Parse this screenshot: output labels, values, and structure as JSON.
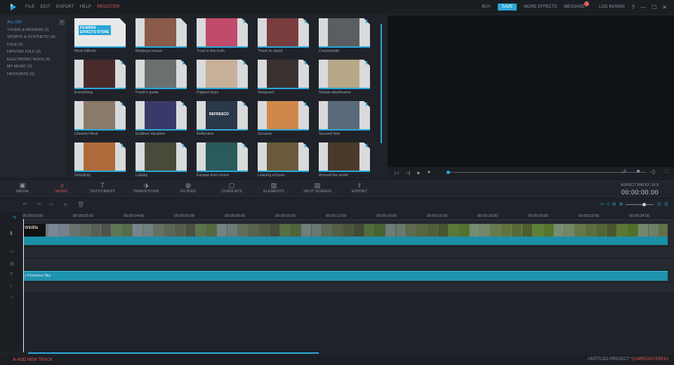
{
  "menu": [
    "FILE",
    "EDIT",
    "EXPORT",
    "HELP"
  ],
  "register_label": "REGISTER",
  "top_right": {
    "buy": "BUY",
    "save": "SAVE",
    "more_effects": "MORE EFFECTS",
    "message": "MESSAGE",
    "message_badge": "1",
    "user": "LOG IN/SIGN"
  },
  "window_controls": [
    "?",
    "—",
    "☐",
    "✕"
  ],
  "categories": [
    "ALL (20)",
    "YOUNG & MODERN (2)",
    "SPORTS & SYNTHETIC (4)",
    "FOLK (3)",
    "HIPSTER FOLK (3)",
    "ELECTRONIC ROCK (4)",
    "MY MUSIC (0)",
    "FAVOURITE (0)"
  ],
  "thumbnails": [
    {
      "label": "More Effects",
      "color": "#e9e9ea",
      "download": false,
      "text": "FILMORA EFFECTS STORE"
    },
    {
      "label": "Birdseye house",
      "color": "#8a5a4a",
      "download": false
    },
    {
      "label": "Trust in the truth",
      "color": "#c24a6a",
      "download": true
    },
    {
      "label": "There to stand",
      "color": "#7a3d3d",
      "download": true
    },
    {
      "label": "Countryside",
      "color": "#5a5e60",
      "download": true
    },
    {
      "label": "Everything",
      "color": "#4a2a2a",
      "download": true
    },
    {
      "label": "Fresh's guitar",
      "color": "#6a7070",
      "download": true
    },
    {
      "label": "Flipped boys",
      "color": "#c8b09a",
      "download": true
    },
    {
      "label": "Vanguard",
      "color": "#3a3030",
      "download": true
    },
    {
      "label": "Simple daydreams",
      "color": "#b8a888",
      "download": true
    },
    {
      "label": "Cheerful Rest",
      "color": "#8a7a6a",
      "download": true
    },
    {
      "label": "Endless Vacation",
      "color": "#3a3a6a",
      "download": true
    },
    {
      "label": "Reflection",
      "color": "#2a3848",
      "download": true,
      "text": "REFRESCO"
    },
    {
      "label": "Sunsets",
      "color": "#d0884a",
      "download": true
    },
    {
      "label": "Second Son",
      "color": "#5a6a7a",
      "download": true
    },
    {
      "label": "Simplicity",
      "color": "#b06a3a",
      "download": true
    },
    {
      "label": "Lullaby",
      "color": "#4a4a3a",
      "download": true
    },
    {
      "label": "Escape from home",
      "color": "#2a5a5a",
      "download": true
    },
    {
      "label": "Leaving echoes",
      "color": "#6a5a3a",
      "download": true
    },
    {
      "label": "Around the world",
      "color": "#4a3a2a",
      "download": true
    }
  ],
  "tools": [
    {
      "label": "MEDIA",
      "icon": "▣",
      "name": "media"
    },
    {
      "label": "MUSIC",
      "icon": "♫",
      "name": "music",
      "active": true
    },
    {
      "label": "TEXT/CREDIT",
      "icon": "T",
      "name": "text-credit"
    },
    {
      "label": "TRANSITIONS",
      "icon": "⬗",
      "name": "transitions"
    },
    {
      "label": "FILTERS",
      "icon": "◍",
      "name": "filters"
    },
    {
      "label": "OVERLAYS",
      "icon": "▢",
      "name": "overlays"
    },
    {
      "label": "ELEMENTS",
      "icon": "▨",
      "name": "elements"
    },
    {
      "label": "SPLIT SCREEN",
      "icon": "▤",
      "name": "split-screen"
    },
    {
      "label": "EXPORT",
      "icon": "⇪",
      "name": "export"
    }
  ],
  "aspect": {
    "label": "ASPECT RATIO: 16:9",
    "timecode": "00:00:00.00"
  },
  "ruler_ticks": [
    "00:00:00:00",
    "00:00:02:00",
    "00:00:04:00",
    "00:00:06:00",
    "00:00:08:00",
    "00:00:10:00",
    "00:00:12:00",
    "00:00:14:00",
    "00:00:16:00",
    "00:00:18:00",
    "00:00:20:00",
    "00:00:22:00",
    "00:00:24:00"
  ],
  "video_clip_label": "Wildlife",
  "audio_clip_label": "Frivolous Sky",
  "add_track": "ADD NEW TRACK",
  "project": {
    "name": "UNTITLED PROJECT",
    "modified": "*(UNREGISTERED)"
  }
}
